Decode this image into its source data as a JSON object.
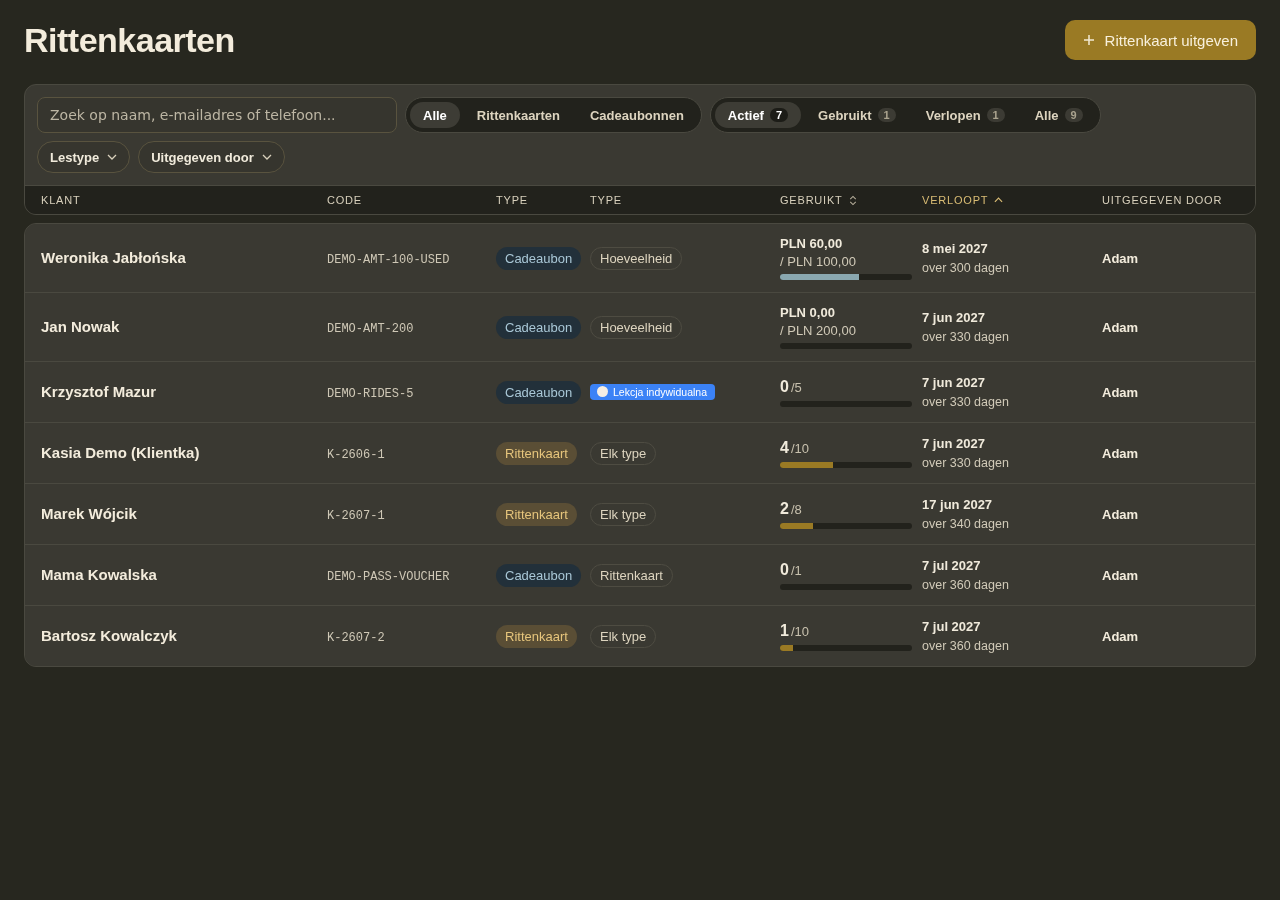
{
  "page": {
    "title": "Rittenkaarten",
    "primary_button": "Rittenkaart uitgeven"
  },
  "search": {
    "placeholder": "Zoek op naam, e-mailadres of telefoon..."
  },
  "type_tabs": [
    {
      "label": "Alle",
      "selected": true
    },
    {
      "label": "Rittenkaarten",
      "selected": false
    },
    {
      "label": "Cadeaubonnen",
      "selected": false
    }
  ],
  "status_tabs": [
    {
      "label": "Actief",
      "count": "7",
      "selected": true
    },
    {
      "label": "Gebruikt",
      "count": "1",
      "selected": false
    },
    {
      "label": "Verlopen",
      "count": "1",
      "selected": false
    },
    {
      "label": "Alle",
      "count": "9",
      "selected": false
    }
  ],
  "dropdowns": [
    "Lestype",
    "Uitgegeven door"
  ],
  "table": {
    "columns": [
      {
        "label": "KLANT"
      },
      {
        "label": "CODE"
      },
      {
        "label": "TYPE"
      },
      {
        "label": "TYPE"
      },
      {
        "label": "GEBRUIKT",
        "sortable": true,
        "sorted": false
      },
      {
        "label": "VERLOOPT",
        "sortable": true,
        "sorted": true
      },
      {
        "label": "UITGEGEVEN DOOR"
      }
    ],
    "rows": [
      {
        "client": "Weronika Jabłońska",
        "code": "DEMO-AMT-100-USED",
        "type": {
          "kind": "voucher",
          "label": "Cadeaubon"
        },
        "subtype": {
          "kind": "plain",
          "label": "Hoeveelheid"
        },
        "usage": {
          "kind": "amount",
          "used": "PLN 60,00",
          "total": "/ PLN 100,00",
          "level": 0.6
        },
        "expires": "8 mei 2027",
        "relative": "over 300 dagen",
        "issued_by": "Adam"
      },
      {
        "client": "Jan Nowak",
        "code": "DEMO-AMT-200",
        "type": {
          "kind": "voucher",
          "label": "Cadeaubon"
        },
        "subtype": {
          "kind": "plain",
          "label": "Hoeveelheid"
        },
        "usage": {
          "kind": "amount",
          "used": "PLN 0,00",
          "total": "/ PLN 200,00",
          "level": 0
        },
        "expires": "7 jun 2027",
        "relative": "over 330 dagen",
        "issued_by": "Adam"
      },
      {
        "client": "Krzysztof Mazur",
        "code": "DEMO-RIDES-5",
        "type": {
          "kind": "voucher",
          "label": "Cadeaubon"
        },
        "subtype": {
          "kind": "lesson",
          "label": "Lekcja indywidualna",
          "color": "#3b82f6"
        },
        "usage": {
          "kind": "count",
          "used": "0",
          "total": "/5",
          "level": 0
        },
        "expires": "7 jun 2027",
        "relative": "over 330 dagen",
        "issued_by": "Adam"
      },
      {
        "client": "Kasia Demo (Klientka)",
        "code": "K-2606-1",
        "type": {
          "kind": "pass",
          "label": "Rittenkaart"
        },
        "subtype": {
          "kind": "plain",
          "label": "Elk type"
        },
        "usage": {
          "kind": "count",
          "used": "4",
          "total": "/10",
          "level": 0.4
        },
        "expires": "7 jun 2027",
        "relative": "over 330 dagen",
        "issued_by": "Adam"
      },
      {
        "client": "Marek Wójcik",
        "code": "K-2607-1",
        "type": {
          "kind": "pass",
          "label": "Rittenkaart"
        },
        "subtype": {
          "kind": "plain",
          "label": "Elk type"
        },
        "usage": {
          "kind": "count",
          "used": "2",
          "total": "/8",
          "level": 0.25
        },
        "expires": "17 jun 2027",
        "relative": "over 340 dagen",
        "issued_by": "Adam"
      },
      {
        "client": "Mama Kowalska",
        "code": "DEMO-PASS-VOUCHER",
        "type": {
          "kind": "voucher",
          "label": "Cadeaubon"
        },
        "subtype": {
          "kind": "plain",
          "label": "Rittenkaart"
        },
        "usage": {
          "kind": "count",
          "used": "0",
          "total": "/1",
          "level": 0
        },
        "expires": "7 jul 2027",
        "relative": "over 360 dagen",
        "issued_by": "Adam"
      },
      {
        "client": "Bartosz Kowalczyk",
        "code": "K-2607-2",
        "type": {
          "kind": "pass",
          "label": "Rittenkaart"
        },
        "subtype": {
          "kind": "plain",
          "label": "Elk type"
        },
        "usage": {
          "kind": "count",
          "used": "1",
          "total": "/10",
          "level": 0.1
        },
        "expires": "7 jul 2027",
        "relative": "over 360 dagen",
        "issued_by": "Adam"
      }
    ]
  }
}
